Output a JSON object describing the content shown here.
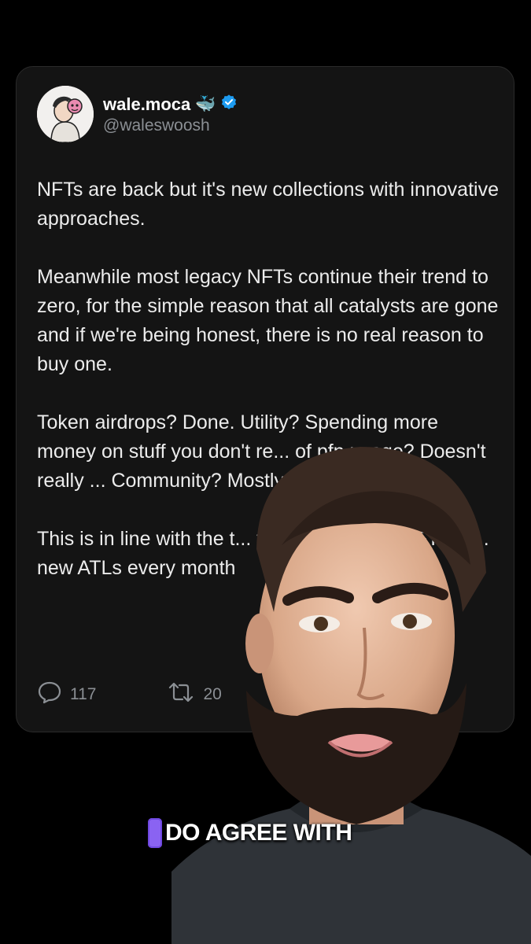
{
  "tweet": {
    "display_name": "wale.moca",
    "name_emoji": "🐳",
    "handle": "@waleswoosh",
    "paragraphs": [
      "NFTs are back but it's new collections with innovative approaches.",
      "Meanwhile most legacy NFTs continue their trend to zero, for the simple reason that all catalysts are gone and if we're being honest, there is no real reason to buy one.",
      "Token airdrops? Done. Utility? Spending more money on stuff you don't re... of pfp usage? Doesn't really ... Community? Mostly dea...",
      "This is in line with the t... formerly big five NFT pro... new ATLs every month"
    ],
    "replies_count": "117",
    "reposts_count": "20"
  },
  "video_overlay": {
    "caption": "DO AGREE WITH",
    "cursor_letter": "I"
  },
  "colors": {
    "background": "#000000",
    "card": "#141414",
    "verified": "#1d9bf0",
    "caption_cursor": "#8a63f2"
  }
}
